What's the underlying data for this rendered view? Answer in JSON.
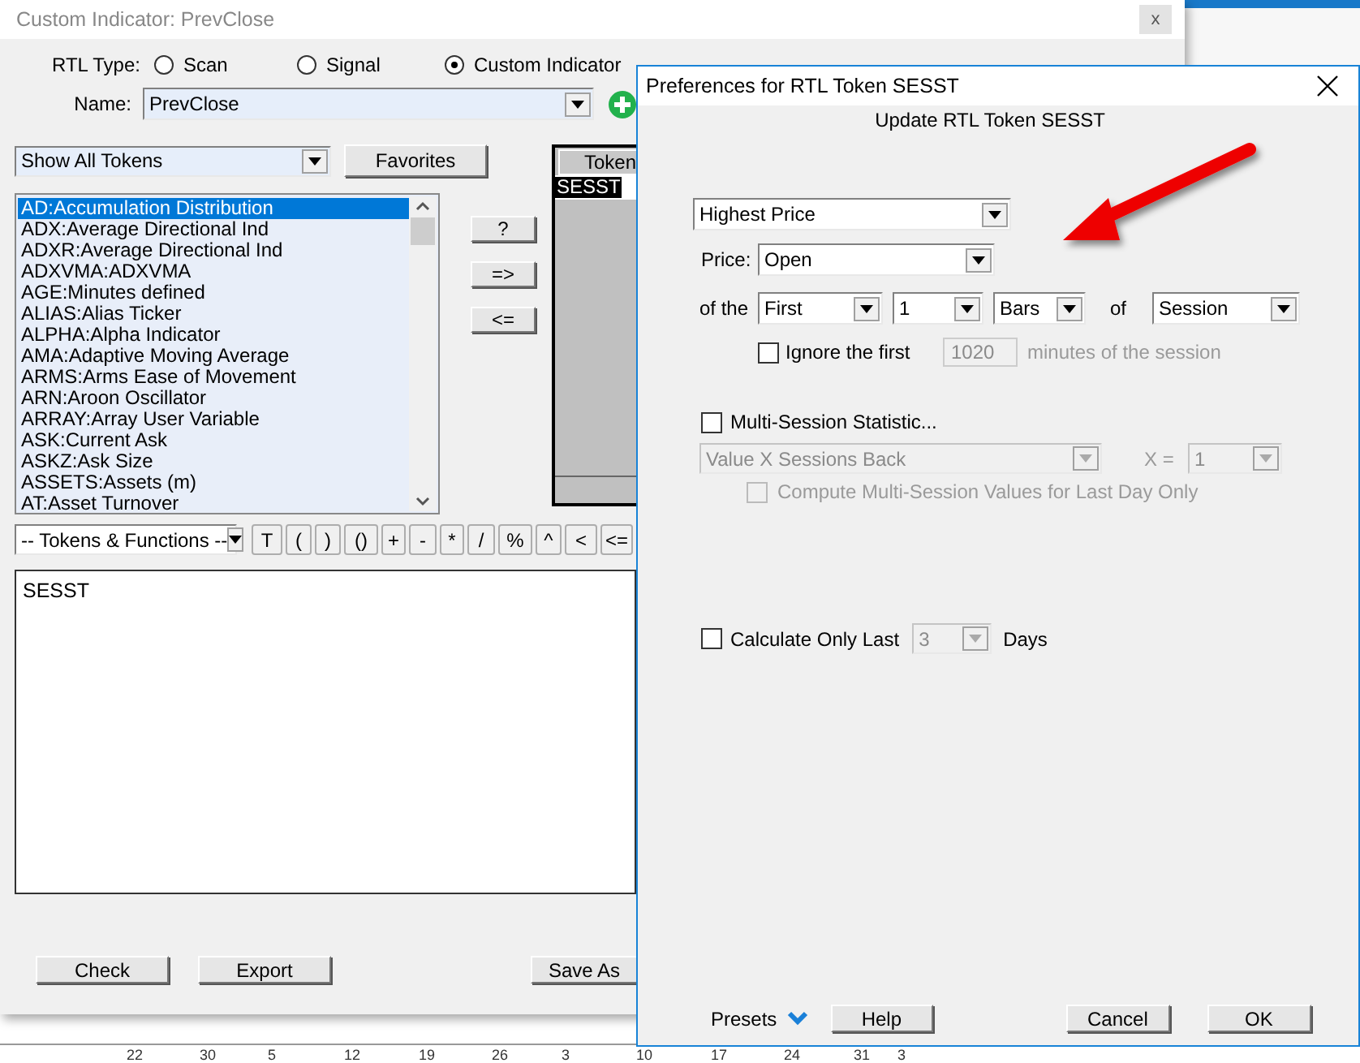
{
  "main_window": {
    "title": "Custom Indicator: PrevClose",
    "close": "x",
    "rtl_type_label": "RTL Type:",
    "rtl_types": [
      {
        "label": "Scan",
        "selected": false
      },
      {
        "label": "Signal",
        "selected": false
      },
      {
        "label": "Custom Indicator",
        "selected": true
      }
    ],
    "name_label": "Name:",
    "name_value": "PrevClose",
    "token_filter": "Show All Tokens",
    "favorites_button": "Favorites",
    "tokens": [
      {
        "label": "AD:Accumulation Distribution",
        "selected": true
      },
      {
        "label": "ADX:Average Directional Ind",
        "selected": false
      },
      {
        "label": "ADXR:Average Directional Ind",
        "selected": false
      },
      {
        "label": "ADXVMA:ADXVMA",
        "selected": false
      },
      {
        "label": "AGE:Minutes defined",
        "selected": false
      },
      {
        "label": "ALIAS:Alias Ticker",
        "selected": false
      },
      {
        "label": "ALPHA:Alpha Indicator",
        "selected": false
      },
      {
        "label": "AMA:Adaptive Moving Average",
        "selected": false
      },
      {
        "label": "ARMS:Arms Ease of Movement",
        "selected": false
      },
      {
        "label": "ARN:Aroon Oscillator",
        "selected": false
      },
      {
        "label": "ARRAY:Array User Variable",
        "selected": false
      },
      {
        "label": "ASK:Current Ask",
        "selected": false
      },
      {
        "label": "ASKZ:Ask Size",
        "selected": false
      },
      {
        "label": "ASSETS:Assets (m)",
        "selected": false
      },
      {
        "label": "AT:Asset Turnover",
        "selected": false
      }
    ],
    "move_buttons": [
      "?",
      "=>",
      "<="
    ],
    "token_table": {
      "header": "Token",
      "rows": [
        {
          "label": "SESST",
          "selected": true
        }
      ]
    },
    "functions_combo": "-- Tokens & Functions --",
    "operators": [
      "T",
      "(",
      ")",
      "()",
      "+",
      "-",
      "*",
      "/",
      "%",
      "^",
      "<",
      "<="
    ],
    "editor_text": "SESST",
    "buttons": [
      "Check",
      "Export",
      "Save As"
    ]
  },
  "dialog": {
    "title": "Preferences for RTL Token SESST",
    "subtitle": "Update RTL Token SESST",
    "statistic": "Highest Price",
    "price_label": "Price:",
    "price": "Open",
    "of_the_label": "of the",
    "position": "First",
    "count": "1",
    "unit": "Bars",
    "of_label": "of",
    "period": "Session",
    "ignore": {
      "label": "Ignore the first",
      "checked": false,
      "value": "1020",
      "disabled": true,
      "suffix": "minutes of the session"
    },
    "multi_session": {
      "label": "Multi-Session Statistic...",
      "checked": false
    },
    "multi_mode": {
      "value": "Value X Sessions Back",
      "disabled": true
    },
    "x_label": "X =",
    "x_value": {
      "value": "1",
      "disabled": true
    },
    "compute": {
      "label": "Compute Multi-Session Values for Last Day Only",
      "checked": false,
      "disabled": true
    },
    "calc_last": {
      "label": "Calculate Only Last",
      "checked": false,
      "value": "3",
      "disabled": true,
      "suffix": "Days"
    },
    "presets": "Presets",
    "buttons": [
      "Help",
      "Cancel",
      "OK"
    ]
  },
  "axis_ticks": [
    "22",
    "30",
    "5",
    "12",
    "19",
    "26",
    "3",
    "10",
    "17",
    "24",
    "31",
    "3"
  ]
}
